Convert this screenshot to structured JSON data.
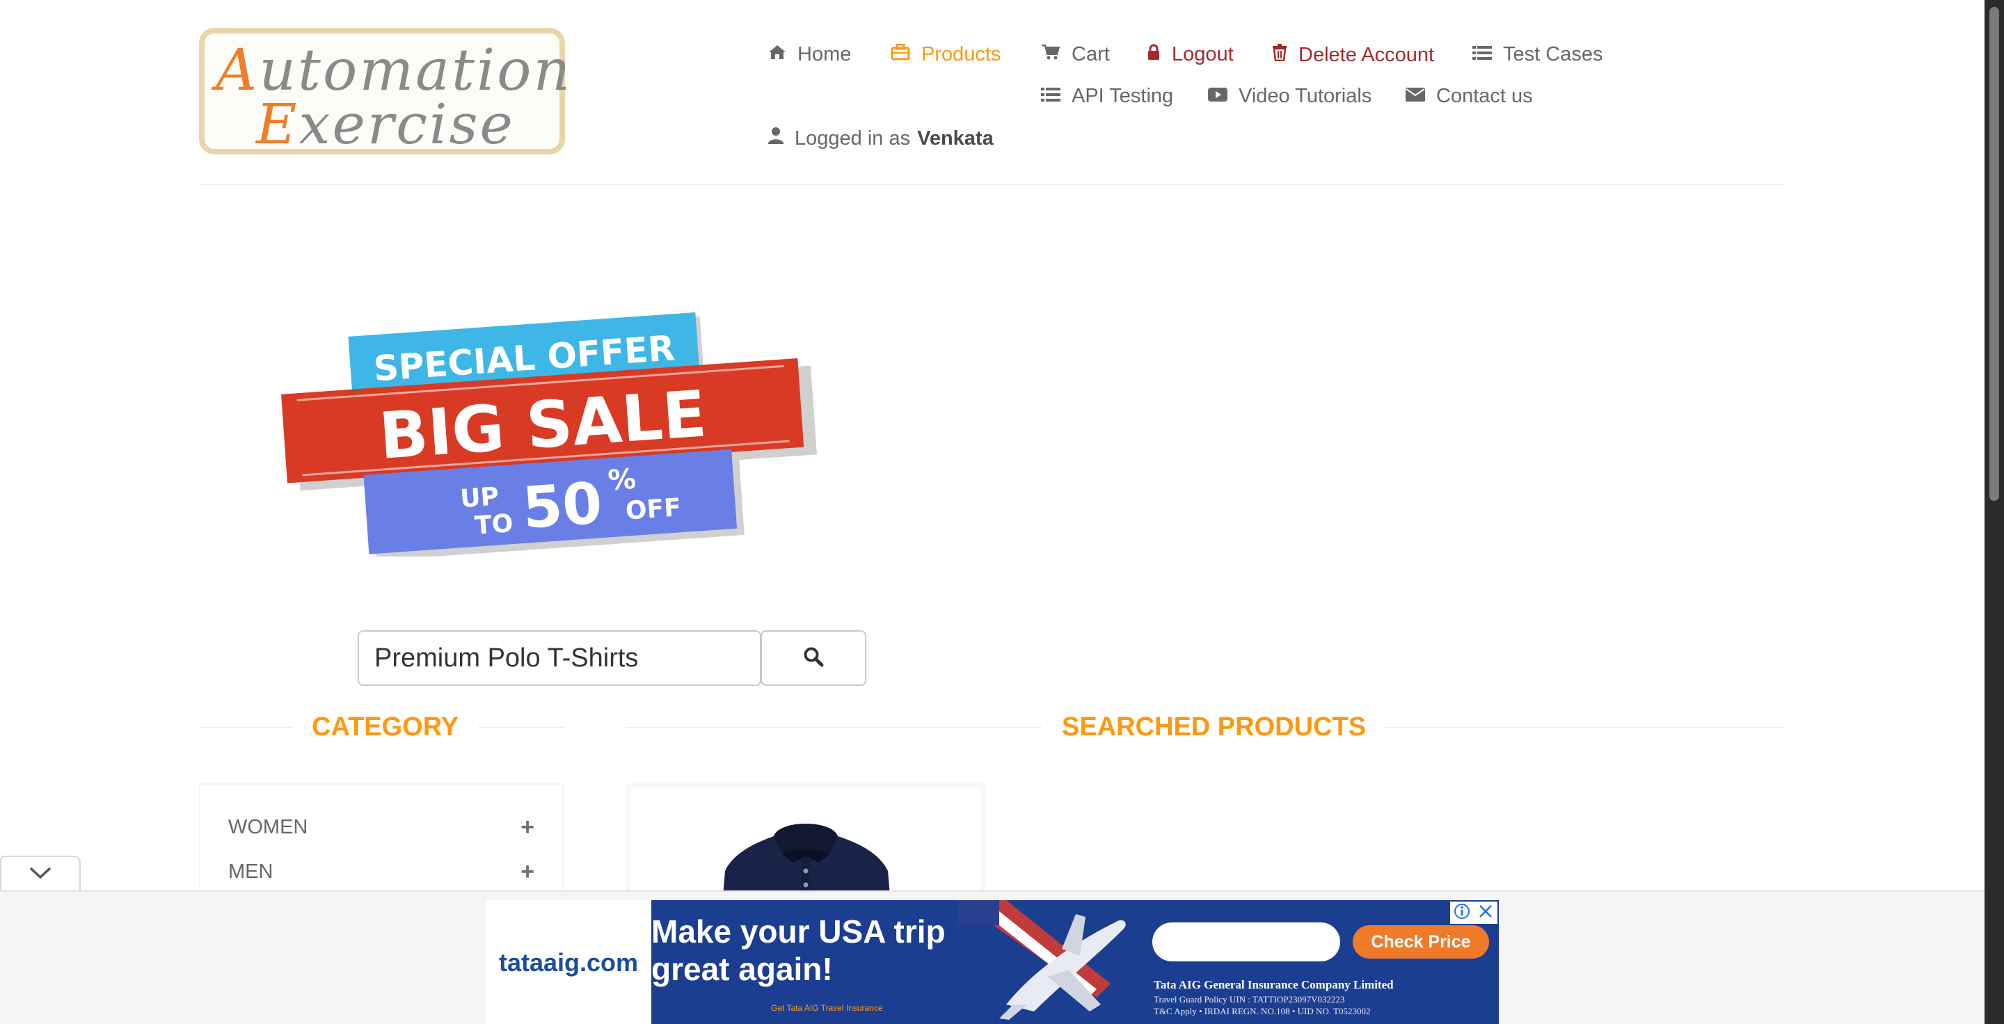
{
  "logo": {
    "line1_first": "A",
    "line1_rest": "utomation",
    "line2_first": "E",
    "line2_rest": "xercise"
  },
  "nav": {
    "home": "Home",
    "products": "Products",
    "cart": "Cart",
    "logout": "Logout",
    "delete_account": "Delete Account",
    "test_cases": "Test Cases",
    "api_testing": "API Testing",
    "video_tutorials": "Video Tutorials",
    "contact_us": "Contact us",
    "logged_in_prefix": "Logged in as",
    "logged_in_user": "Venkata"
  },
  "sale_banner": {
    "line1": "SPECIAL OFFER",
    "line2": "BIG SALE",
    "up": "UP",
    "to": "TO",
    "amount": "50",
    "percent": "%",
    "off": "OFF"
  },
  "search": {
    "value": "Premium Polo T-Shirts",
    "button_icon": "search-icon"
  },
  "sidebar": {
    "title": "CATEGORY",
    "categories": [
      {
        "label": "WOMEN",
        "toggle": "+"
      },
      {
        "label": "MEN",
        "toggle": "+"
      }
    ]
  },
  "main": {
    "title": "SEARCHED PRODUCTS",
    "product_icon": "polo-shirt-image"
  },
  "ad": {
    "brand": "tataaig.com",
    "headline": "Make your USA trip\ngreat again!",
    "small_text": "Get Tata AIG Travel Insurance",
    "cta": "Check Price",
    "company": "Tata AIG General Insurance Company Limited",
    "fine1": "Travel Guard Policy UIN : TATTIOP23097V032223",
    "fine2": "T&C Apply  •  IRDAI REGN. NO.108  •  UID NO. T0523002"
  },
  "colors": {
    "accent": "#fe980f",
    "danger": "#a52a2a",
    "text": "#696763",
    "ad_blue": "#1c3e90",
    "ad_orange": "#ef7b2a"
  }
}
